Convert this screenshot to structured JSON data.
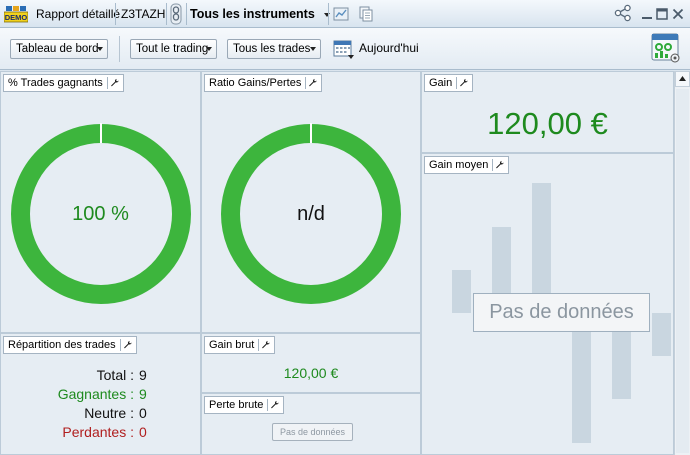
{
  "titlebar": {
    "demo_badge": "DEMO",
    "report_title": "Rapport détaillé",
    "account": "Z3TAZH",
    "instruments": "Tous les instruments",
    "icons": [
      "link-icon",
      "chart-export-icon",
      "copy-icon",
      "share-icon",
      "minimize-icon",
      "maximize-icon",
      "close-icon"
    ]
  },
  "toolbar": {
    "dashboard": "Tableau de bord",
    "trading": "Tout le trading",
    "trades": "Tous les trades",
    "date": "Aujourd'hui",
    "icons": [
      "calendar-icon",
      "layout-widgets-icon"
    ]
  },
  "panels": {
    "win_trades": {
      "title": "% Trades gagnants",
      "value": "100 %",
      "fill_fraction": 1.0
    },
    "gain_loss_ratio": {
      "title": "Ratio Gains/Pertes",
      "value": "n/d",
      "fill_fraction": 1.0
    },
    "gain": {
      "title": "Gain",
      "value": "120,00 €"
    },
    "avg_gain": {
      "title": "Gain moyen",
      "no_data": "Pas de données"
    },
    "breakdown": {
      "title": "Répartition des trades",
      "rows": [
        {
          "label": "Total :",
          "value": "9"
        },
        {
          "label": "Gagnantes :",
          "value": "9"
        },
        {
          "label": "Neutre :",
          "value": "0"
        },
        {
          "label": "Perdantes :",
          "value": "0"
        }
      ]
    },
    "gross_gain": {
      "title": "Gain brut",
      "value": "120,00 €"
    },
    "gross_loss": {
      "title": "Perte brute",
      "no_data": "Pas de données"
    }
  },
  "colors": {
    "green": "#3db53d",
    "text_green": "#1e8a1e",
    "text_red": "#b01e1e",
    "ghost_bar": "#c9d6e0"
  }
}
